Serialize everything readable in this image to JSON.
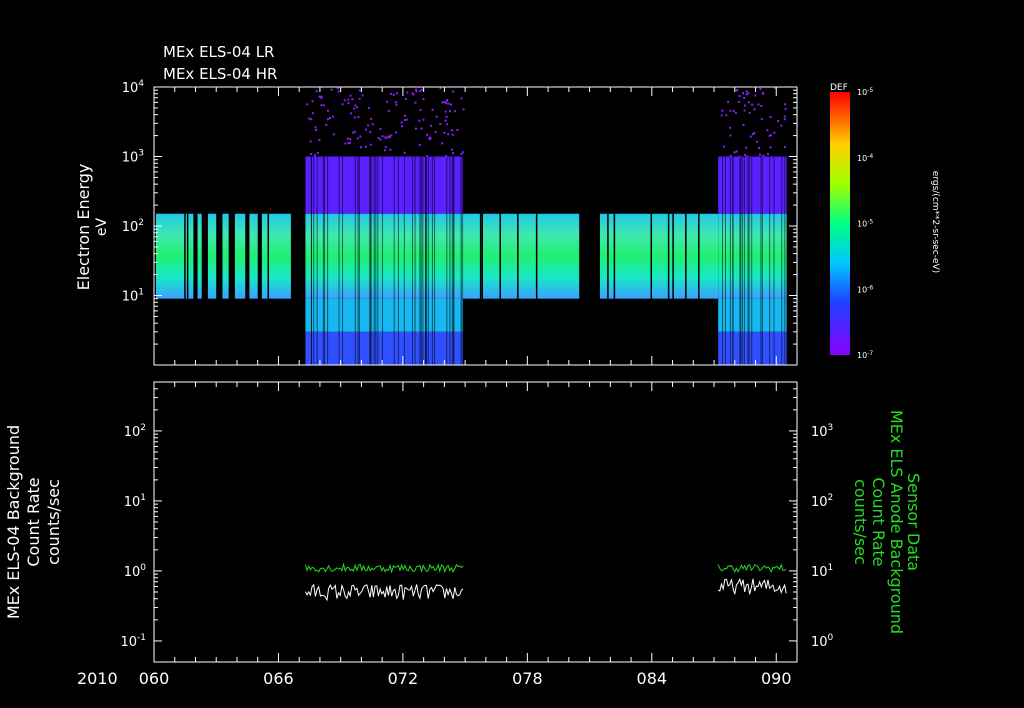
{
  "titles": [
    "MEx ELS-04 LR",
    "MEx ELS-04 HR"
  ],
  "colors": {
    "axis": "#ffffff",
    "primary": "#ffffff",
    "secondary": "#22dd22",
    "background": "#000000"
  },
  "chart_data": [
    {
      "type": "heatmap",
      "ylabel": "Electron Energy",
      "yunit": "eV",
      "yscale": "log",
      "ylim": [
        1,
        10000
      ],
      "xlim": [
        60,
        91
      ],
      "yticks": [
        {
          "base": "10",
          "exp": "1",
          "value": 10
        },
        {
          "base": "10",
          "exp": "2",
          "value": 100
        },
        {
          "base": "10",
          "exp": "3",
          "value": 1000
        },
        {
          "base": "10",
          "exp": "4",
          "value": 10000
        }
      ],
      "colorbar": {
        "label": "DEF",
        "unit": "ergs/(cm**2-sr-sec-eV)",
        "ticks": [
          {
            "base": "10",
            "exp": "-5",
            "value": 1e-05
          },
          {
            "base": "10",
            "exp": "-4",
            "value": 0.0001
          },
          {
            "base": "10",
            "exp": "-5",
            "value": 1e-05
          },
          {
            "base": "10",
            "exp": "-6",
            "value": 1e-06
          },
          {
            "base": "10",
            "exp": "-7",
            "value": 1e-07
          }
        ]
      },
      "blocks": [
        {
          "start": 60.0,
          "end": 61.9,
          "emin": 9,
          "emax": 150,
          "mode": "LR"
        },
        {
          "start": 62.1,
          "end": 62.3,
          "emin": 9,
          "emax": 150,
          "mode": "LR"
        },
        {
          "start": 62.6,
          "end": 63.0,
          "emin": 9,
          "emax": 150,
          "mode": "LR"
        },
        {
          "start": 63.3,
          "end": 63.6,
          "emin": 9,
          "emax": 150,
          "mode": "LR"
        },
        {
          "start": 63.9,
          "end": 64.4,
          "emin": 9,
          "emax": 150,
          "mode": "LR"
        },
        {
          "start": 64.6,
          "end": 65.0,
          "emin": 9,
          "emax": 150,
          "mode": "LR"
        },
        {
          "start": 65.2,
          "end": 66.6,
          "emin": 9,
          "emax": 150,
          "mode": "LR"
        },
        {
          "start": 67.3,
          "end": 74.9,
          "emin": 1,
          "emax": 10000,
          "mode": "HR"
        },
        {
          "start": 74.9,
          "end": 80.5,
          "emin": 9,
          "emax": 150,
          "mode": "LR"
        },
        {
          "start": 81.5,
          "end": 87.2,
          "emin": 9,
          "emax": 150,
          "mode": "LR"
        },
        {
          "start": 87.2,
          "end": 90.5,
          "emin": 1,
          "emax": 10000,
          "mode": "HR"
        }
      ]
    },
    {
      "type": "line",
      "ylabel_lines": [
        "MEx ELS-04 Background",
        "Count Rate",
        "counts/sec"
      ],
      "y2label_lines": [
        "Sensor Data",
        "MEx ELS Anode Background",
        "Count Rate",
        "counts/sec"
      ],
      "yscale": "log",
      "ylim": [
        0.05,
        500
      ],
      "y2lim": [
        0.5,
        5000
      ],
      "xlim": [
        60,
        91
      ],
      "yticks": [
        {
          "base": "10",
          "exp": "-1",
          "value": 0.1
        },
        {
          "base": "10",
          "exp": "0",
          "value": 1
        },
        {
          "base": "10",
          "exp": "1",
          "value": 10
        },
        {
          "base": "10",
          "exp": "2",
          "value": 100
        }
      ],
      "y2ticks": [
        {
          "base": "10",
          "exp": "0",
          "value": 1
        },
        {
          "base": "10",
          "exp": "1",
          "value": 10
        },
        {
          "base": "10",
          "exp": "2",
          "value": 100
        },
        {
          "base": "10",
          "exp": "3",
          "value": 1000
        }
      ],
      "series": [
        {
          "axis": "left",
          "segments": [
            {
              "start": 67.3,
              "end": 74.9,
              "level": 0.5
            },
            {
              "start": 87.2,
              "end": 90.5,
              "level": 0.6
            }
          ]
        },
        {
          "axis": "right",
          "segments": [
            {
              "start": 67.3,
              "end": 74.9,
              "level": 11
            },
            {
              "start": 87.2,
              "end": 90.5,
              "level": 11
            }
          ]
        }
      ],
      "xyear": "2010",
      "xticks": [
        {
          "label": "060",
          "value": 60
        },
        {
          "label": "066",
          "value": 66
        },
        {
          "label": "072",
          "value": 72
        },
        {
          "label": "078",
          "value": 78
        },
        {
          "label": "084",
          "value": 84
        },
        {
          "label": "090",
          "value": 90
        }
      ]
    }
  ]
}
